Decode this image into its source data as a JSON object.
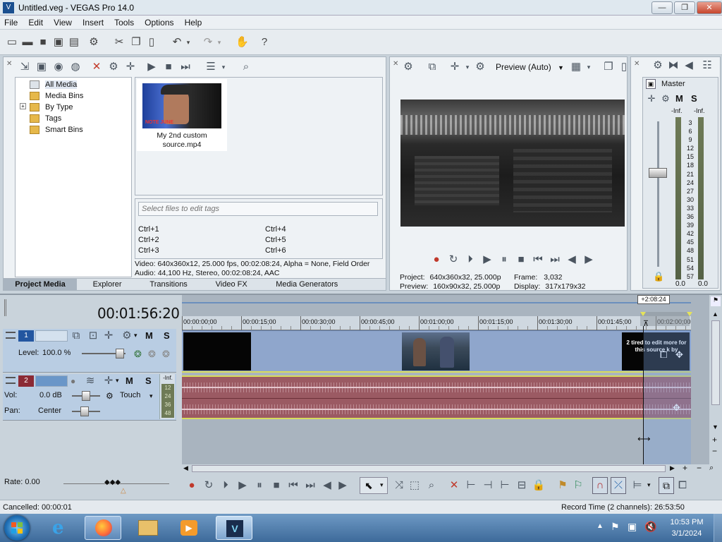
{
  "window": {
    "title": "Untitled.veg - VEGAS Pro 14.0",
    "minimize": "—",
    "maximize": "❐",
    "close": "✕"
  },
  "menu": [
    "File",
    "Edit",
    "View",
    "Insert",
    "Tools",
    "Options",
    "Help"
  ],
  "project_media": {
    "tree": [
      "All Media",
      "Media Bins",
      "By Type",
      "Tags",
      "Smart Bins"
    ],
    "tree_expander": "+",
    "thumbnail_caption": "My 2nd custom source.mp4",
    "thumbnail_overlay": "NOTE JUNE",
    "tags_placeholder": "Select files to edit tags",
    "shortcuts": [
      "Ctrl+1",
      "Ctrl+2",
      "Ctrl+3",
      "Ctrl+4",
      "Ctrl+5",
      "Ctrl+6"
    ],
    "info_video": "Video: 640x360x12, 25.000 fps, 00:02:08:24, Alpha = None, Field Order",
    "info_audio": "Audio: 44,100 Hz, Stereo, 00:02:08:24, AAC"
  },
  "tabs": [
    "Project Media",
    "Explorer",
    "Transitions",
    "Video FX",
    "Media Generators"
  ],
  "preview": {
    "mode": "Preview (Auto)",
    "project_label": "Project:",
    "project_value": "640x360x32, 25.000p",
    "preview_label": "Preview:",
    "preview_value": "160x90x32, 25.000p",
    "frame_label": "Frame:",
    "frame_value": "3,032",
    "display_label": "Display:",
    "display_value": "317x179x32"
  },
  "mixer": {
    "master": "Master",
    "m": "M",
    "s": "S",
    "inf_left": "-Inf.",
    "inf_right": "-Inf.",
    "scale": [
      "3",
      "6",
      "9",
      "12",
      "15",
      "18",
      "21",
      "24",
      "27",
      "30",
      "33",
      "36",
      "39",
      "42",
      "45",
      "48",
      "51",
      "54",
      "57"
    ],
    "readout_left": "0.0",
    "readout_right": "0.0"
  },
  "timeline": {
    "timecode": "00:01:56:20",
    "cursor_flag": "+2:08:24",
    "ruler": [
      "00:00:00;00",
      "00:00:15;00",
      "00:00:30;00",
      "00:00:45;00",
      "00:01:00;00",
      "00:01:15;00",
      "00:01:30;00",
      "00:01:45;00",
      "00:02:00;00"
    ],
    "clip_text": "2 tired to edit more for this source k by",
    "video_track": {
      "number": "1",
      "level_label": "Level:",
      "level_value": "100.0 %",
      "m": "M",
      "s": "S"
    },
    "audio_track": {
      "number": "2",
      "vol_label": "Vol:",
      "vol_value": "0.0 dB",
      "pan_label": "Pan:",
      "pan_value": "Center",
      "automation": "Touch",
      "m": "M",
      "s": "S",
      "meter_inf": "-Inf.",
      "meter_scale": [
        "12",
        "24",
        "36",
        "48"
      ]
    },
    "rate": "Rate: 0.00"
  },
  "status": {
    "left": "Cancelled: 00:00:01",
    "right": "Record Time (2 channels): 26:53:50"
  },
  "taskbar": {
    "time": "10:53 PM",
    "date": "3/1/2024"
  },
  "colors": {
    "video_track_bg": "#8fa6cc",
    "audio_track_bg": "#9b5a63",
    "track_header_blue": "#b8cde4",
    "timeline_bg": "#a7b2bd",
    "accent_yellow": "#e5e35a"
  }
}
